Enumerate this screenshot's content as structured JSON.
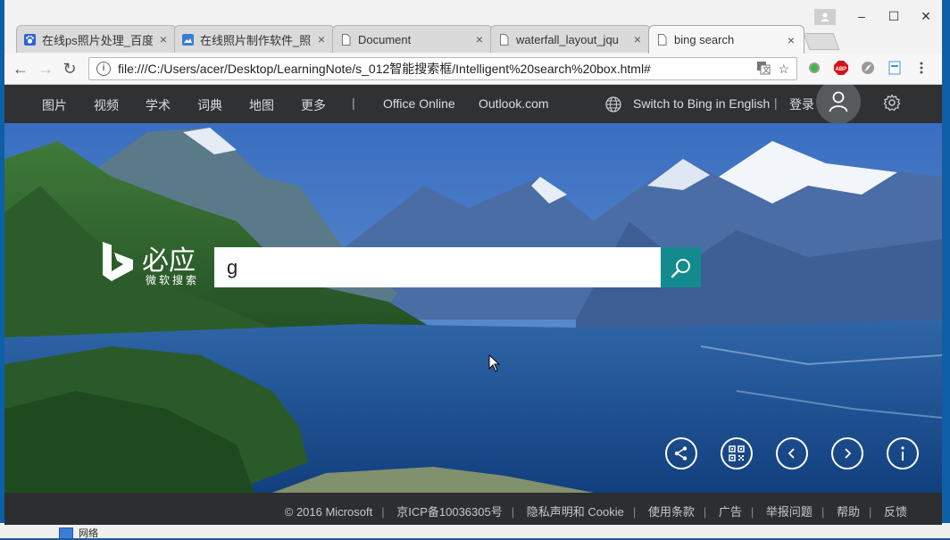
{
  "browser": {
    "tabs": [
      {
        "title": "在线ps照片处理_百度",
        "icon": "paw-icon"
      },
      {
        "title": "在线照片制作软件_照",
        "icon": "image-icon"
      },
      {
        "title": "Document",
        "icon": "document-icon"
      },
      {
        "title": "waterfall_layout_jqu",
        "icon": "document-icon"
      },
      {
        "title": "bing search",
        "icon": "document-icon",
        "active": true
      }
    ],
    "close_glyph": "×",
    "address": "file:///C:/Users/acer/Desktop/LearningNote/s_012智能搜索框/Intelligent%20search%20box.html#",
    "window_controls": [
      "–",
      "☐",
      "✕"
    ]
  },
  "nav": {
    "items": [
      "图片",
      "视频",
      "学术",
      "词典",
      "地图",
      "更多"
    ],
    "separator": "|",
    "links": [
      "Office Online",
      "Outlook.com"
    ],
    "switch_lang": "Switch to Bing in English",
    "login": "登录"
  },
  "brand": {
    "name": "必应",
    "subtitle": "微软搜索"
  },
  "search": {
    "value": "g",
    "placeholder": ""
  },
  "controls": [
    "share-icon",
    "qr-code-icon",
    "prev-icon",
    "next-icon",
    "info-icon"
  ],
  "footer": {
    "links": [
      "© 2016 Microsoft",
      "京ICP备10036305号",
      "隐私声明和 Cookie",
      "使用条款",
      "广告",
      "举报问题",
      "帮助",
      "反馈"
    ],
    "separator": "|"
  },
  "desktop": {
    "taskbar_item": "网络"
  },
  "colors": {
    "nav_bg": "#2f3133",
    "search_button": "#138a8e",
    "footer_bg": "#2c2e30"
  }
}
